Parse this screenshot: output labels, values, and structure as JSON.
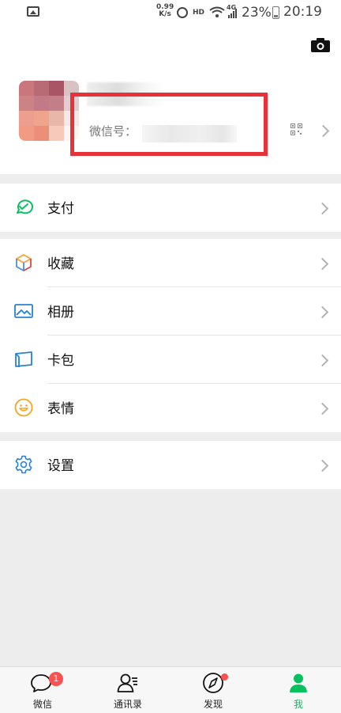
{
  "status_bar": {
    "speed_value": "0.99",
    "speed_unit": "K/s",
    "hd": "HD",
    "network": "4G",
    "battery": "23%",
    "time": "20:19"
  },
  "profile": {
    "wechat_id_label": "微信号："
  },
  "menu": {
    "pay": "支付",
    "favorites": "收藏",
    "album": "相册",
    "card_pack": "卡包",
    "stickers": "表情",
    "settings": "设置"
  },
  "tabbar": {
    "chats": "微信",
    "chats_badge": "1",
    "contacts": "通讯录",
    "discover": "发现",
    "me": "我"
  },
  "colors": {
    "accent": "#07c160",
    "highlight_box": "#e8323a",
    "badge": "#fa5151"
  },
  "icons": [
    "image-icon",
    "alarm-icon",
    "wifi-icon",
    "signal-icon",
    "battery-icon",
    "camera-icon",
    "qr-code-icon",
    "chevron-right-icon",
    "pay-icon",
    "favorites-icon",
    "album-icon",
    "card-pack-icon",
    "sticker-icon",
    "settings-gear-icon",
    "chat-bubble-icon",
    "contacts-icon",
    "compass-icon",
    "me-person-icon"
  ]
}
